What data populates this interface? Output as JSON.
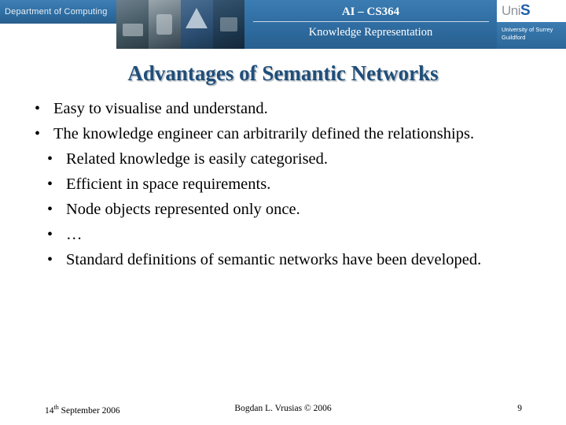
{
  "header": {
    "department_banner": "Department of Computing",
    "course_code": "AI – CS364",
    "course_subtitle": "Knowledge Representation",
    "logo_uni": "Uni",
    "logo_s": "S",
    "logo_caption": "University of Surrey\nGuildford"
  },
  "slide": {
    "title": "Advantages of Semantic Networks",
    "bullets": [
      {
        "marker": "•",
        "text": "Easy to visualise and understand.",
        "indent": false
      },
      {
        "marker": "•",
        "text": "The knowledge engineer can arbitrarily defined the relationships.",
        "indent": false
      },
      {
        "marker": "•",
        "text": "Related knowledge is easily categorised.",
        "indent": true
      },
      {
        "marker": "•",
        "text": "Efficient in space requirements.",
        "indent": true
      },
      {
        "marker": "•",
        "text": "Node objects represented only once.",
        "indent": true
      },
      {
        "marker": "•",
        "text": "…",
        "indent": true
      },
      {
        "marker": "•",
        "text": "Standard definitions of semantic networks have been developed.",
        "indent": true
      }
    ]
  },
  "footer": {
    "date_main": "14",
    "date_sup": "th",
    "date_rest": " September 2006",
    "author": "Bogdan L. Vrusias © 2006",
    "page_number": "9"
  },
  "colors": {
    "header_blue": "#2f6da2",
    "title_blue": "#1f4e79",
    "logo_blue": "#1f5fa8"
  }
}
